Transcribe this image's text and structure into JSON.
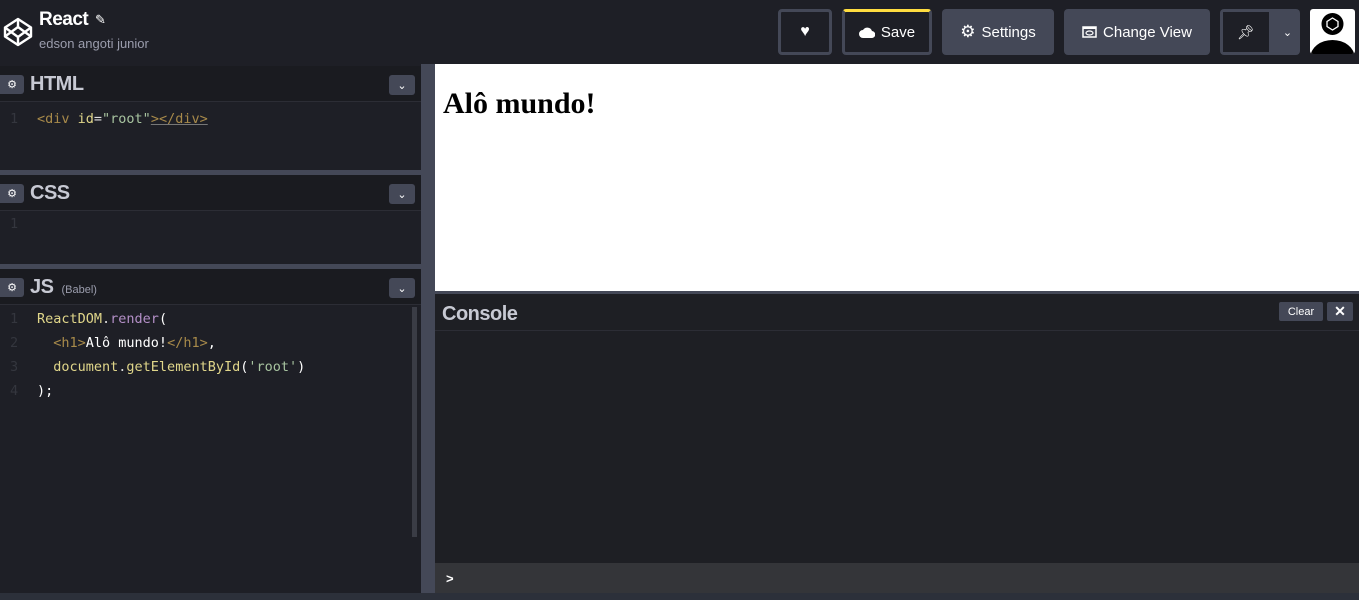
{
  "header": {
    "title": "React",
    "author": "edson angoti junior",
    "icons": {
      "logo": "codepen-logo",
      "edit": "pencil-icon"
    },
    "buttons": {
      "love_icon": "heart-icon",
      "save": "Save",
      "settings": "Settings",
      "change_view": "Change View",
      "pin_icon": "pin-icon"
    }
  },
  "editors": {
    "html": {
      "name": "HTML",
      "lines": [
        "1"
      ]
    },
    "css": {
      "name": "CSS",
      "lines": [
        "1"
      ]
    },
    "js": {
      "name": "JS",
      "sub": "(Babel)",
      "lines": [
        "1",
        "2",
        "3",
        "4"
      ]
    }
  },
  "code": {
    "html1": [
      "<div ",
      "id",
      "=",
      "\"root\"",
      "></div>"
    ],
    "js": {
      "l1a": "ReactDOM",
      "l1b": ".",
      "l1c": "render",
      "l1d": "(",
      "l2a": "  <h1>",
      "l2b": "Alô mundo!",
      "l2c": "</h1>",
      "l2d": ",",
      "l3a": "  document",
      "l3b": ".",
      "l3c": "getElementById",
      "l3d": "(",
      "l3e": "'root'",
      "l3f": ")",
      "l4": ");"
    }
  },
  "preview": {
    "heading": "Alô mundo!"
  },
  "console": {
    "title": "Console",
    "clear": "Clear",
    "close": "✕",
    "prompt": ">"
  },
  "colors": {
    "bg": "#1e1f26",
    "panel": "#444857",
    "save_accent": "#ffdd40"
  }
}
